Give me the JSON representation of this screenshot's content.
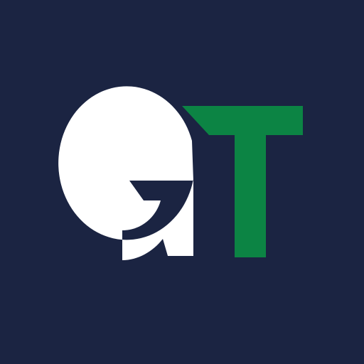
{
  "logo": {
    "text": "GT",
    "letters": [
      "G",
      "T"
    ]
  },
  "colors": {
    "background": "#1b2442",
    "letter_g": "#ffffff",
    "letter_t": "#0c8444"
  }
}
